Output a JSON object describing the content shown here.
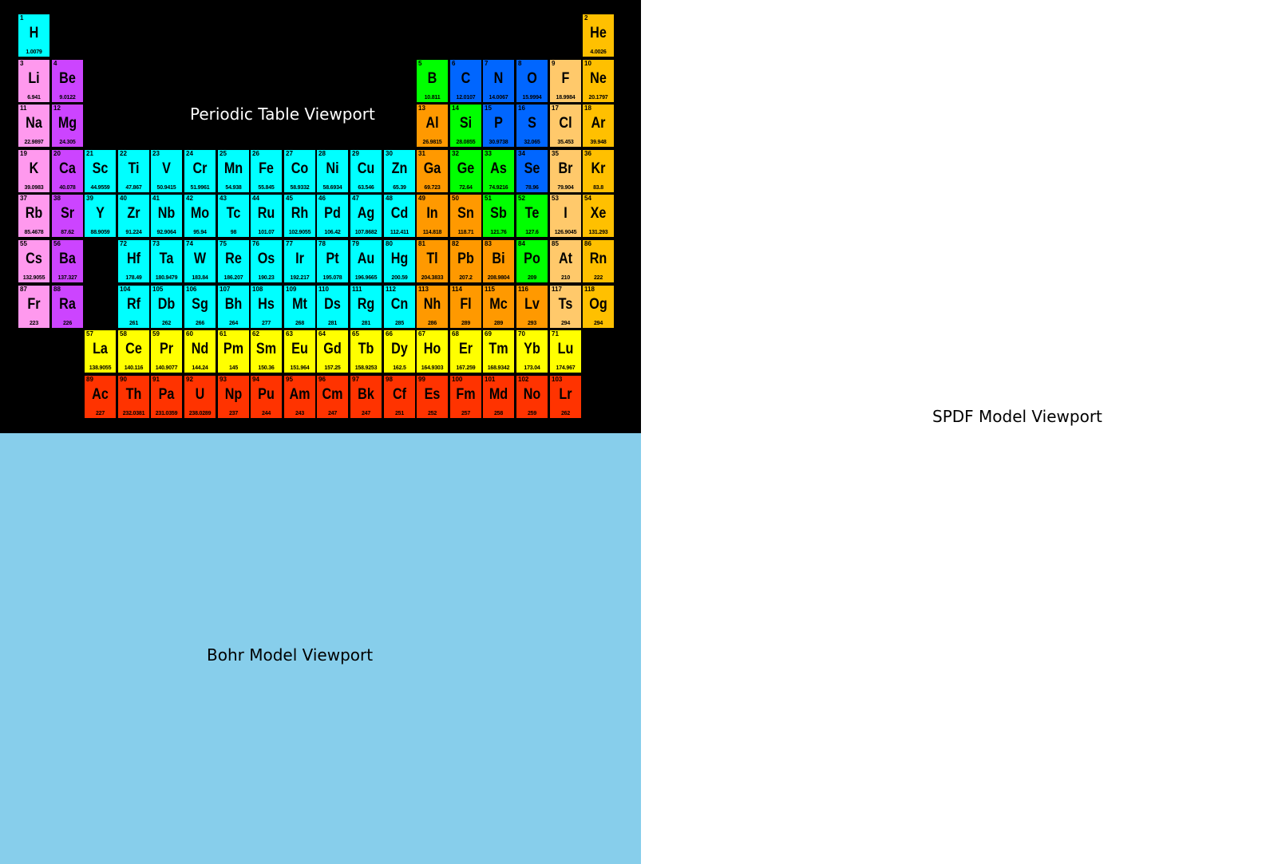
{
  "viewports": {
    "periodic_table": "Periodic Table Viewport",
    "bohr": "Bohr Model Viewport",
    "spdf": "SPDF Model Viewport"
  },
  "colors": {
    "periodic_background": "#000000",
    "bohr_background": "#87ceeb",
    "spdf_background": "#ffffff",
    "categories": {
      "nonmetal": "#00ff00",
      "reactive": "#0066ff",
      "halogen": "#ffc96b",
      "noble": "#ffc000",
      "alkali": "#ff99ee",
      "alkaline": "#cc44ff",
      "transition": "#00ffff",
      "post": "#ff9900",
      "lanthanide": "#ffff00",
      "actinide": "#ff3300"
    }
  },
  "elements": [
    {
      "n": "1",
      "s": "H",
      "m": "1.0079",
      "c": "transition",
      "col": 1,
      "row": 1
    },
    {
      "n": "2",
      "s": "He",
      "m": "4.0026",
      "c": "noble",
      "col": 18,
      "row": 1
    },
    {
      "n": "3",
      "s": "Li",
      "m": "6.941",
      "c": "alkali",
      "col": 1,
      "row": 2
    },
    {
      "n": "4",
      "s": "Be",
      "m": "9.0122",
      "c": "alkaline",
      "col": 2,
      "row": 2
    },
    {
      "n": "5",
      "s": "B",
      "m": "10.811",
      "c": "nonmetal",
      "col": 13,
      "row": 2
    },
    {
      "n": "6",
      "s": "C",
      "m": "12.0107",
      "c": "reactive",
      "col": 14,
      "row": 2
    },
    {
      "n": "7",
      "s": "N",
      "m": "14.0067",
      "c": "reactive",
      "col": 15,
      "row": 2
    },
    {
      "n": "8",
      "s": "O",
      "m": "15.9994",
      "c": "reactive",
      "col": 16,
      "row": 2
    },
    {
      "n": "9",
      "s": "F",
      "m": "18.9984",
      "c": "halogen",
      "col": 17,
      "row": 2
    },
    {
      "n": "10",
      "s": "Ne",
      "m": "20.1797",
      "c": "noble",
      "col": 18,
      "row": 2
    },
    {
      "n": "11",
      "s": "Na",
      "m": "22.9897",
      "c": "alkali",
      "col": 1,
      "row": 3
    },
    {
      "n": "12",
      "s": "Mg",
      "m": "24.305",
      "c": "alkaline",
      "col": 2,
      "row": 3
    },
    {
      "n": "13",
      "s": "Al",
      "m": "26.9815",
      "c": "post",
      "col": 13,
      "row": 3
    },
    {
      "n": "14",
      "s": "Si",
      "m": "28.0855",
      "c": "nonmetal",
      "col": 14,
      "row": 3
    },
    {
      "n": "15",
      "s": "P",
      "m": "30.9738",
      "c": "reactive",
      "col": 15,
      "row": 3
    },
    {
      "n": "16",
      "s": "S",
      "m": "32.065",
      "c": "reactive",
      "col": 16,
      "row": 3
    },
    {
      "n": "17",
      "s": "Cl",
      "m": "35.453",
      "c": "halogen",
      "col": 17,
      "row": 3
    },
    {
      "n": "18",
      "s": "Ar",
      "m": "39.948",
      "c": "noble",
      "col": 18,
      "row": 3
    },
    {
      "n": "19",
      "s": "K",
      "m": "39.0983",
      "c": "alkali",
      "col": 1,
      "row": 4
    },
    {
      "n": "20",
      "s": "Ca",
      "m": "40.078",
      "c": "alkaline",
      "col": 2,
      "row": 4
    },
    {
      "n": "21",
      "s": "Sc",
      "m": "44.9559",
      "c": "transition",
      "col": 3,
      "row": 4
    },
    {
      "n": "22",
      "s": "Ti",
      "m": "47.867",
      "c": "transition",
      "col": 4,
      "row": 4
    },
    {
      "n": "23",
      "s": "V",
      "m": "50.9415",
      "c": "transition",
      "col": 5,
      "row": 4
    },
    {
      "n": "24",
      "s": "Cr",
      "m": "51.9961",
      "c": "transition",
      "col": 6,
      "row": 4
    },
    {
      "n": "25",
      "s": "Mn",
      "m": "54.938",
      "c": "transition",
      "col": 7,
      "row": 4
    },
    {
      "n": "26",
      "s": "Fe",
      "m": "55.845",
      "c": "transition",
      "col": 8,
      "row": 4
    },
    {
      "n": "27",
      "s": "Co",
      "m": "58.9332",
      "c": "transition",
      "col": 9,
      "row": 4
    },
    {
      "n": "28",
      "s": "Ni",
      "m": "58.6934",
      "c": "transition",
      "col": 10,
      "row": 4
    },
    {
      "n": "29",
      "s": "Cu",
      "m": "63.546",
      "c": "transition",
      "col": 11,
      "row": 4
    },
    {
      "n": "30",
      "s": "Zn",
      "m": "65.39",
      "c": "transition",
      "col": 12,
      "row": 4
    },
    {
      "n": "31",
      "s": "Ga",
      "m": "69.723",
      "c": "post",
      "col": 13,
      "row": 4
    },
    {
      "n": "32",
      "s": "Ge",
      "m": "72.64",
      "c": "nonmetal",
      "col": 14,
      "row": 4
    },
    {
      "n": "33",
      "s": "As",
      "m": "74.9216",
      "c": "nonmetal",
      "col": 15,
      "row": 4
    },
    {
      "n": "34",
      "s": "Se",
      "m": "78.96",
      "c": "reactive",
      "col": 16,
      "row": 4
    },
    {
      "n": "35",
      "s": "Br",
      "m": "79.904",
      "c": "halogen",
      "col": 17,
      "row": 4
    },
    {
      "n": "36",
      "s": "Kr",
      "m": "83.8",
      "c": "noble",
      "col": 18,
      "row": 4
    },
    {
      "n": "37",
      "s": "Rb",
      "m": "85.4678",
      "c": "alkali",
      "col": 1,
      "row": 5
    },
    {
      "n": "38",
      "s": "Sr",
      "m": "87.62",
      "c": "alkaline",
      "col": 2,
      "row": 5
    },
    {
      "n": "39",
      "s": "Y",
      "m": "88.9059",
      "c": "transition",
      "col": 3,
      "row": 5
    },
    {
      "n": "40",
      "s": "Zr",
      "m": "91.224",
      "c": "transition",
      "col": 4,
      "row": 5
    },
    {
      "n": "41",
      "s": "Nb",
      "m": "92.9064",
      "c": "transition",
      "col": 5,
      "row": 5
    },
    {
      "n": "42",
      "s": "Mo",
      "m": "95.94",
      "c": "transition",
      "col": 6,
      "row": 5
    },
    {
      "n": "43",
      "s": "Tc",
      "m": "98",
      "c": "transition",
      "col": 7,
      "row": 5
    },
    {
      "n": "44",
      "s": "Ru",
      "m": "101.07",
      "c": "transition",
      "col": 8,
      "row": 5
    },
    {
      "n": "45",
      "s": "Rh",
      "m": "102.9055",
      "c": "transition",
      "col": 9,
      "row": 5
    },
    {
      "n": "46",
      "s": "Pd",
      "m": "106.42",
      "c": "transition",
      "col": 10,
      "row": 5
    },
    {
      "n": "47",
      "s": "Ag",
      "m": "107.8682",
      "c": "transition",
      "col": 11,
      "row": 5
    },
    {
      "n": "48",
      "s": "Cd",
      "m": "112.411",
      "c": "transition",
      "col": 12,
      "row": 5
    },
    {
      "n": "49",
      "s": "In",
      "m": "114.818",
      "c": "post",
      "col": 13,
      "row": 5
    },
    {
      "n": "50",
      "s": "Sn",
      "m": "118.71",
      "c": "post",
      "col": 14,
      "row": 5
    },
    {
      "n": "51",
      "s": "Sb",
      "m": "121.76",
      "c": "nonmetal",
      "col": 15,
      "row": 5
    },
    {
      "n": "52",
      "s": "Te",
      "m": "127.6",
      "c": "nonmetal",
      "col": 16,
      "row": 5
    },
    {
      "n": "53",
      "s": "I",
      "m": "126.9045",
      "c": "halogen",
      "col": 17,
      "row": 5
    },
    {
      "n": "54",
      "s": "Xe",
      "m": "131.293",
      "c": "noble",
      "col": 18,
      "row": 5
    },
    {
      "n": "55",
      "s": "Cs",
      "m": "132.9055",
      "c": "alkali",
      "col": 1,
      "row": 6
    },
    {
      "n": "56",
      "s": "Ba",
      "m": "137.327",
      "c": "alkaline",
      "col": 2,
      "row": 6
    },
    {
      "n": "72",
      "s": "Hf",
      "m": "178.49",
      "c": "transition",
      "col": 4,
      "row": 6
    },
    {
      "n": "73",
      "s": "Ta",
      "m": "180.9479",
      "c": "transition",
      "col": 5,
      "row": 6
    },
    {
      "n": "74",
      "s": "W",
      "m": "183.84",
      "c": "transition",
      "col": 6,
      "row": 6
    },
    {
      "n": "75",
      "s": "Re",
      "m": "186.207",
      "c": "transition",
      "col": 7,
      "row": 6
    },
    {
      "n": "76",
      "s": "Os",
      "m": "190.23",
      "c": "transition",
      "col": 8,
      "row": 6
    },
    {
      "n": "77",
      "s": "Ir",
      "m": "192.217",
      "c": "transition",
      "col": 9,
      "row": 6
    },
    {
      "n": "78",
      "s": "Pt",
      "m": "195.078",
      "c": "transition",
      "col": 10,
      "row": 6
    },
    {
      "n": "79",
      "s": "Au",
      "m": "196.9665",
      "c": "transition",
      "col": 11,
      "row": 6
    },
    {
      "n": "80",
      "s": "Hg",
      "m": "200.59",
      "c": "transition",
      "col": 12,
      "row": 6
    },
    {
      "n": "81",
      "s": "Tl",
      "m": "204.3833",
      "c": "post",
      "col": 13,
      "row": 6
    },
    {
      "n": "82",
      "s": "Pb",
      "m": "207.2",
      "c": "post",
      "col": 14,
      "row": 6
    },
    {
      "n": "83",
      "s": "Bi",
      "m": "208.9804",
      "c": "post",
      "col": 15,
      "row": 6
    },
    {
      "n": "84",
      "s": "Po",
      "m": "209",
      "c": "nonmetal",
      "col": 16,
      "row": 6
    },
    {
      "n": "85",
      "s": "At",
      "m": "210",
      "c": "halogen",
      "col": 17,
      "row": 6
    },
    {
      "n": "86",
      "s": "Rn",
      "m": "222",
      "c": "noble",
      "col": 18,
      "row": 6
    },
    {
      "n": "87",
      "s": "Fr",
      "m": "223",
      "c": "alkali",
      "col": 1,
      "row": 7
    },
    {
      "n": "88",
      "s": "Ra",
      "m": "226",
      "c": "alkaline",
      "col": 2,
      "row": 7
    },
    {
      "n": "104",
      "s": "Rf",
      "m": "261",
      "c": "transition",
      "col": 4,
      "row": 7
    },
    {
      "n": "105",
      "s": "Db",
      "m": "262",
      "c": "transition",
      "col": 5,
      "row": 7
    },
    {
      "n": "106",
      "s": "Sg",
      "m": "266",
      "c": "transition",
      "col": 6,
      "row": 7
    },
    {
      "n": "107",
      "s": "Bh",
      "m": "264",
      "c": "transition",
      "col": 7,
      "row": 7
    },
    {
      "n": "108",
      "s": "Hs",
      "m": "277",
      "c": "transition",
      "col": 8,
      "row": 7
    },
    {
      "n": "109",
      "s": "Mt",
      "m": "268",
      "c": "transition",
      "col": 9,
      "row": 7
    },
    {
      "n": "110",
      "s": "Ds",
      "m": "281",
      "c": "transition",
      "col": 10,
      "row": 7
    },
    {
      "n": "111",
      "s": "Rg",
      "m": "281",
      "c": "transition",
      "col": 11,
      "row": 7
    },
    {
      "n": "112",
      "s": "Cn",
      "m": "285",
      "c": "transition",
      "col": 12,
      "row": 7
    },
    {
      "n": "113",
      "s": "Nh",
      "m": "286",
      "c": "post",
      "col": 13,
      "row": 7
    },
    {
      "n": "114",
      "s": "Fl",
      "m": "289",
      "c": "post",
      "col": 14,
      "row": 7
    },
    {
      "n": "115",
      "s": "Mc",
      "m": "289",
      "c": "post",
      "col": 15,
      "row": 7
    },
    {
      "n": "116",
      "s": "Lv",
      "m": "293",
      "c": "post",
      "col": 16,
      "row": 7
    },
    {
      "n": "117",
      "s": "Ts",
      "m": "294",
      "c": "halogen",
      "col": 17,
      "row": 7
    },
    {
      "n": "118",
      "s": "Og",
      "m": "294",
      "c": "noble",
      "col": 18,
      "row": 7
    },
    {
      "n": "57",
      "s": "La",
      "m": "138.9055",
      "c": "lanthanide",
      "col": 3,
      "row": 8
    },
    {
      "n": "58",
      "s": "Ce",
      "m": "140.116",
      "c": "lanthanide",
      "col": 4,
      "row": 8
    },
    {
      "n": "59",
      "s": "Pr",
      "m": "140.9077",
      "c": "lanthanide",
      "col": 5,
      "row": 8
    },
    {
      "n": "60",
      "s": "Nd",
      "m": "144.24",
      "c": "lanthanide",
      "col": 6,
      "row": 8
    },
    {
      "n": "61",
      "s": "Pm",
      "m": "145",
      "c": "lanthanide",
      "col": 7,
      "row": 8
    },
    {
      "n": "62",
      "s": "Sm",
      "m": "150.36",
      "c": "lanthanide",
      "col": 8,
      "row": 8
    },
    {
      "n": "63",
      "s": "Eu",
      "m": "151.964",
      "c": "lanthanide",
      "col": 9,
      "row": 8
    },
    {
      "n": "64",
      "s": "Gd",
      "m": "157.25",
      "c": "lanthanide",
      "col": 10,
      "row": 8
    },
    {
      "n": "65",
      "s": "Tb",
      "m": "158.9253",
      "c": "lanthanide",
      "col": 11,
      "row": 8
    },
    {
      "n": "66",
      "s": "Dy",
      "m": "162.5",
      "c": "lanthanide",
      "col": 12,
      "row": 8
    },
    {
      "n": "67",
      "s": "Ho",
      "m": "164.9303",
      "c": "lanthanide",
      "col": 13,
      "row": 8
    },
    {
      "n": "68",
      "s": "Er",
      "m": "167.259",
      "c": "lanthanide",
      "col": 14,
      "row": 8
    },
    {
      "n": "69",
      "s": "Tm",
      "m": "168.9342",
      "c": "lanthanide",
      "col": 15,
      "row": 8
    },
    {
      "n": "70",
      "s": "Yb",
      "m": "173.04",
      "c": "lanthanide",
      "col": 16,
      "row": 8
    },
    {
      "n": "71",
      "s": "Lu",
      "m": "174.967",
      "c": "lanthanide",
      "col": 17,
      "row": 8
    },
    {
      "n": "89",
      "s": "Ac",
      "m": "227",
      "c": "actinide",
      "col": 3,
      "row": 9
    },
    {
      "n": "90",
      "s": "Th",
      "m": "232.0381",
      "c": "actinide",
      "col": 4,
      "row": 9
    },
    {
      "n": "91",
      "s": "Pa",
      "m": "231.0359",
      "c": "actinide",
      "col": 5,
      "row": 9
    },
    {
      "n": "92",
      "s": "U",
      "m": "238.0289",
      "c": "actinide",
      "col": 6,
      "row": 9
    },
    {
      "n": "93",
      "s": "Np",
      "m": "237",
      "c": "actinide",
      "col": 7,
      "row": 9
    },
    {
      "n": "94",
      "s": "Pu",
      "m": "244",
      "c": "actinide",
      "col": 8,
      "row": 9
    },
    {
      "n": "95",
      "s": "Am",
      "m": "243",
      "c": "actinide",
      "col": 9,
      "row": 9
    },
    {
      "n": "96",
      "s": "Cm",
      "m": "247",
      "c": "actinide",
      "col": 10,
      "row": 9
    },
    {
      "n": "97",
      "s": "Bk",
      "m": "247",
      "c": "actinide",
      "col": 11,
      "row": 9
    },
    {
      "n": "98",
      "s": "Cf",
      "m": "251",
      "c": "actinide",
      "col": 12,
      "row": 9
    },
    {
      "n": "99",
      "s": "Es",
      "m": "252",
      "c": "actinide",
      "col": 13,
      "row": 9
    },
    {
      "n": "100",
      "s": "Fm",
      "m": "257",
      "c": "actinide",
      "col": 14,
      "row": 9
    },
    {
      "n": "101",
      "s": "Md",
      "m": "258",
      "c": "actinide",
      "col": 15,
      "row": 9
    },
    {
      "n": "102",
      "s": "No",
      "m": "259",
      "c": "actinide",
      "col": 16,
      "row": 9
    },
    {
      "n": "103",
      "s": "Lr",
      "m": "262",
      "c": "actinide",
      "col": 17,
      "row": 9
    }
  ]
}
